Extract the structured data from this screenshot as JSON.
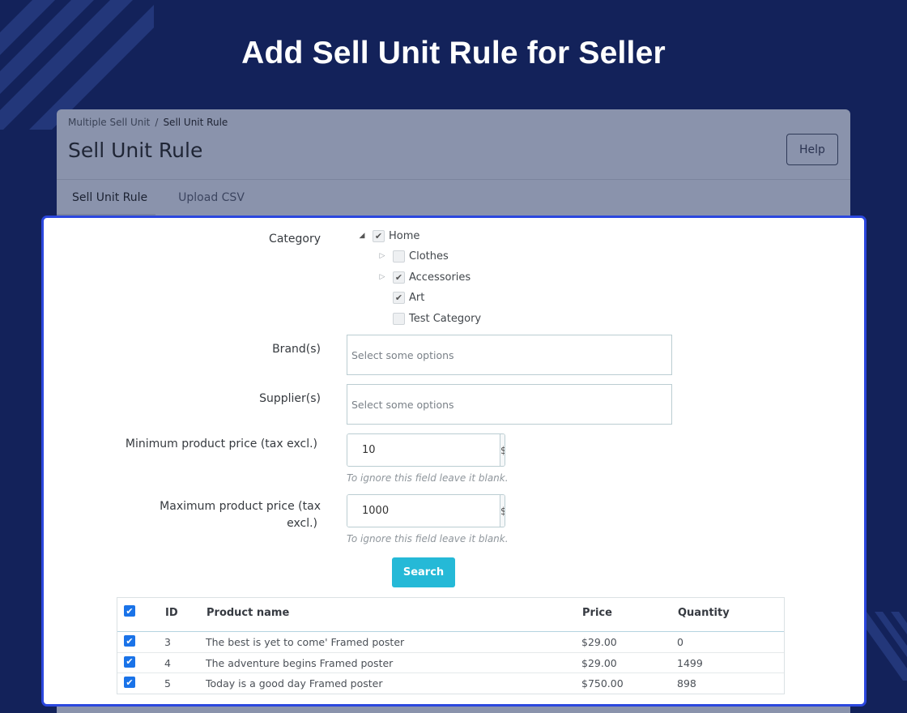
{
  "hero": {
    "title": "Add Sell Unit Rule for Seller"
  },
  "breadcrumb": {
    "parent": "Multiple Sell Unit",
    "separator": "/",
    "current": "Sell Unit Rule"
  },
  "header": {
    "title": "Sell Unit Rule",
    "help_label": "Help"
  },
  "tabs": [
    {
      "label": "Sell Unit Rule",
      "active": true
    },
    {
      "label": "Upload CSV",
      "active": false
    }
  ],
  "form": {
    "category": {
      "label": "Category",
      "tree": {
        "home": {
          "label": "Home",
          "checked": true,
          "expanded": true
        },
        "clothes": {
          "label": "Clothes",
          "checked": false,
          "expandable": true
        },
        "accessories": {
          "label": "Accessories",
          "checked": true,
          "expandable": true
        },
        "art": {
          "label": "Art",
          "checked": true
        },
        "test_category": {
          "label": "Test Category",
          "checked": false
        }
      }
    },
    "brands": {
      "label": "Brand(s)",
      "placeholder": "Select some options"
    },
    "suppliers": {
      "label": "Supplier(s)",
      "placeholder": "Select some options"
    },
    "min_price": {
      "label": "Minimum product price (tax excl.)",
      "value": "10",
      "currency": "$",
      "help": "To ignore this field leave it blank."
    },
    "max_price": {
      "label_line1": "Maximum product price (tax",
      "label_line2": "excl.)",
      "value": "1000",
      "currency": "$",
      "help": "To ignore this field leave it blank."
    },
    "search_label": "Search"
  },
  "table": {
    "columns": {
      "id": "ID",
      "name": "Product name",
      "price": "Price",
      "quantity": "Quantity"
    },
    "rows": [
      {
        "checked": true,
        "id": "3",
        "name": "The best is yet to come' Framed poster",
        "price": "$29.00",
        "quantity": "0"
      },
      {
        "checked": true,
        "id": "4",
        "name": "The adventure begins Framed poster",
        "price": "$29.00",
        "quantity": "1499"
      },
      {
        "checked": true,
        "id": "5",
        "name": "Today is a good day Framed poster",
        "price": "$750.00",
        "quantity": "898"
      }
    ]
  },
  "colors": {
    "background": "#13225a",
    "card_border": "#2b47de",
    "search_button": "#25b9d7",
    "checkbox": "#1a73e8"
  }
}
